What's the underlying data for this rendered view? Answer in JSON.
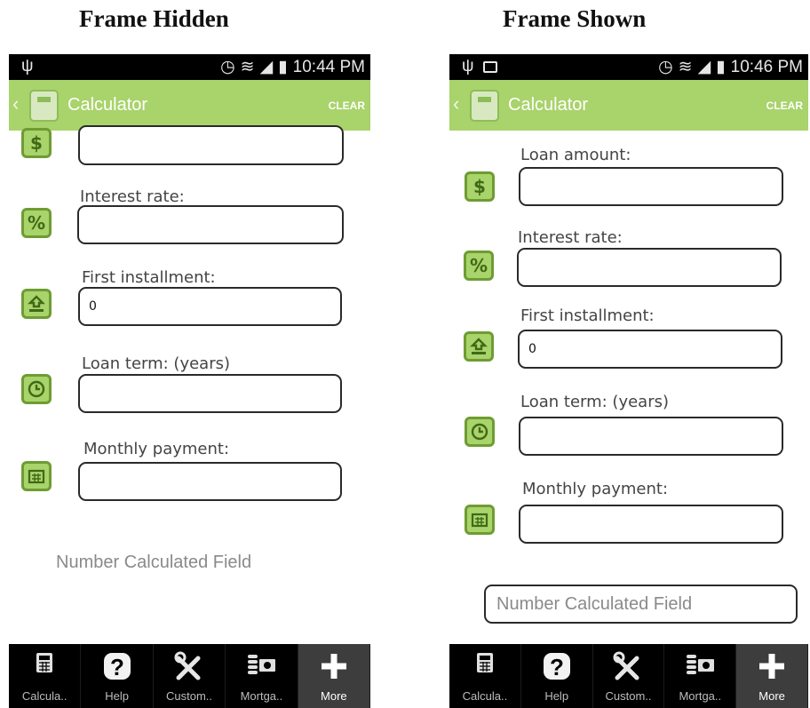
{
  "figure": {
    "left_title": "Frame Hidden",
    "right_title": "Frame Shown"
  },
  "left_screen": {
    "status": {
      "usb": "ψ",
      "alarm": "⏰",
      "wifi": "📶",
      "time": "10:44 PM"
    },
    "app_bar": {
      "back": "‹",
      "title": "Calculator",
      "clear": "CLEAR"
    },
    "fields": [
      {
        "label": "",
        "value": "",
        "icon": "dollar-icon"
      },
      {
        "label": "Interest rate:",
        "value": "",
        "icon": "percent-icon"
      },
      {
        "label": "First installment:",
        "value": "0",
        "icon": "upload-tray-icon"
      },
      {
        "label": "Loan term: (years)",
        "value": "",
        "icon": "clock-icon"
      },
      {
        "label": "Monthly payment:",
        "value": "",
        "icon": "calendar-icon"
      }
    ],
    "calculated_field": "Number Calculated Field",
    "nav": [
      {
        "label": "Calcula..",
        "icon": "calculator-icon"
      },
      {
        "label": "Help",
        "icon": "help-icon"
      },
      {
        "label": "Custom..",
        "icon": "tools-icon"
      },
      {
        "label": "Mortga..",
        "icon": "money-icon"
      },
      {
        "label": "More",
        "icon": "plus-icon",
        "active": true
      }
    ]
  },
  "right_screen": {
    "status": {
      "usb": "ψ",
      "image": "🖼",
      "alarm": "⏰",
      "wifi": "📶",
      "time": "10:46 PM"
    },
    "app_bar": {
      "back": "‹",
      "title": "Calculator",
      "clear": "CLEAR"
    },
    "fields": [
      {
        "label": "Loan amount:",
        "value": "",
        "icon": "dollar-icon"
      },
      {
        "label": "Interest rate:",
        "value": "",
        "icon": "percent-icon"
      },
      {
        "label": "First installment:",
        "value": "0",
        "icon": "upload-tray-icon"
      },
      {
        "label": "Loan term: (years)",
        "value": "",
        "icon": "clock-icon"
      },
      {
        "label": "Monthly payment:",
        "value": "",
        "icon": "calendar-icon"
      }
    ],
    "calculated_field": "Number Calculated Field",
    "nav": [
      {
        "label": "Calcula..",
        "icon": "calculator-icon"
      },
      {
        "label": "Help",
        "icon": "help-icon"
      },
      {
        "label": "Custom..",
        "icon": "tools-icon"
      },
      {
        "label": "Mortga..",
        "icon": "money-icon"
      },
      {
        "label": "More",
        "icon": "plus-icon",
        "active": true
      }
    ]
  },
  "colors": {
    "accent_green": "#a9d36b",
    "icon_border": "#6e9c33",
    "nav_bg": "#000000",
    "nav_active": "#3d3d3d"
  }
}
